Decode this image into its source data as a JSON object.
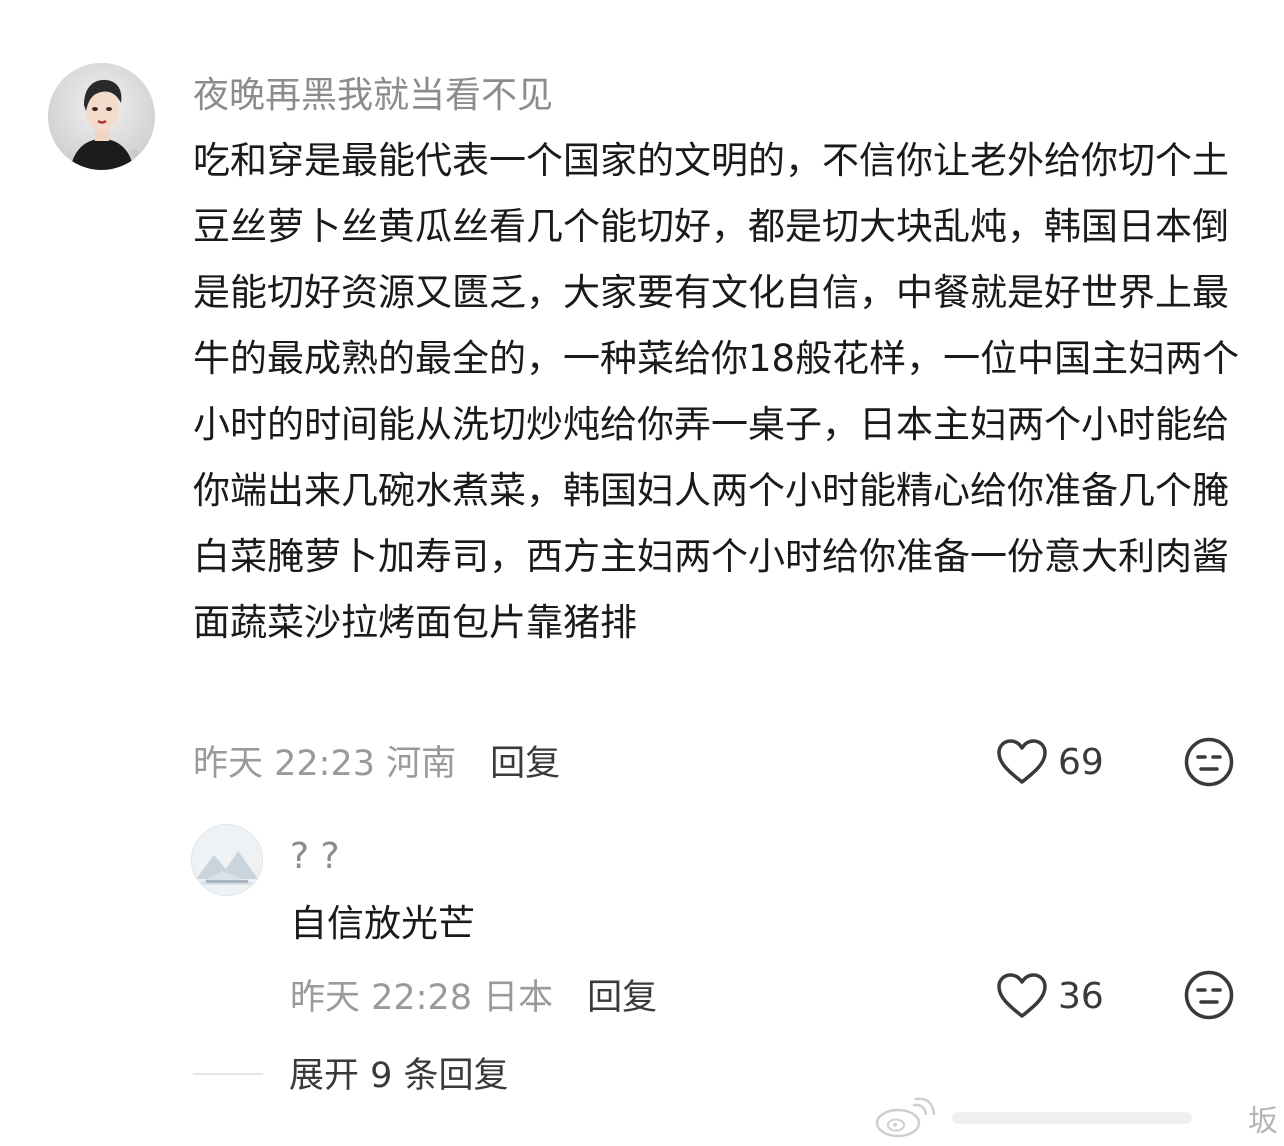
{
  "comment": {
    "username": "夜晚再黑我就当看不见",
    "text": "吃和穿是最能代表一个国家的文明的，不信你让老外给你切个土豆丝萝卜丝黄瓜丝看几个能切好，都是切大块乱炖，韩国日本倒是能切好资源又匮乏，大家要有文化自信，中餐就是好世界上最牛的最成熟的最全的，一种菜给你18般花样，一位中国主妇两个小时的时间能从洗切炒炖给你弄一桌子，日本主妇两个小时能给你端出来几碗水煮菜，韩国妇人两个小时能精心给你准备几个腌白菜腌萝卜加寿司，西方主妇两个小时给你准备一份意大利肉酱面蔬菜沙拉烤面包片靠猪排",
    "time_location": "昨天 22:23 河南",
    "reply_label": "回复",
    "like_count": "69",
    "avatar_icon": "user-avatar-photo",
    "like_icon": "heart-outline-icon",
    "dislike_icon": "neutral-face-icon"
  },
  "reply": {
    "username": "? ?",
    "text": "自信放光芒",
    "time_location": "昨天 22:28 日本",
    "reply_label": "回复",
    "like_count": "36",
    "avatar_icon": "default-landscape-avatar",
    "like_icon": "heart-outline-icon",
    "dislike_icon": "neutral-face-icon"
  },
  "expand": {
    "label": "展开 9 条回复"
  },
  "watermark": {
    "text": "坂"
  },
  "colors": {
    "text_primary": "#1a1a1a",
    "text_secondary": "#8c8c8c",
    "meta": "#9a9a9a",
    "action": "#3a3a3a",
    "background": "#ffffff"
  }
}
